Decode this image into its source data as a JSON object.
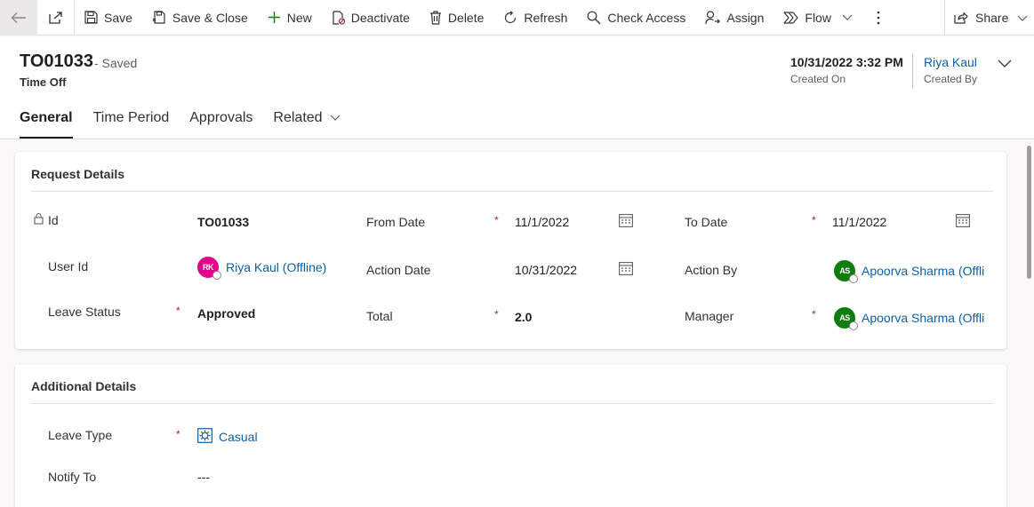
{
  "commands": {
    "save": "Save",
    "save_close": "Save & Close",
    "new": "New",
    "deactivate": "Deactivate",
    "delete": "Delete",
    "refresh": "Refresh",
    "check_access": "Check Access",
    "assign": "Assign",
    "flow": "Flow",
    "share": "Share"
  },
  "header": {
    "record_id": "TO01033",
    "save_status": "- Saved",
    "entity": "Time Off",
    "created_on_value": "10/31/2022 3:32 PM",
    "created_on_label": "Created On",
    "created_by_value": "Riya Kaul",
    "created_by_label": "Created By"
  },
  "tabs": [
    "General",
    "Time Period",
    "Approvals",
    "Related"
  ],
  "request_details": {
    "title": "Request Details",
    "id_label": "Id",
    "id_value": "TO01033",
    "from_date_label": "From Date",
    "from_date_value": "11/1/2022",
    "to_date_label": "To Date",
    "to_date_value": "11/1/2022",
    "user_id_label": "User Id",
    "user_initials": "RK",
    "user_value": "Riya Kaul (Offline)",
    "action_date_label": "Action Date",
    "action_date_value": "10/31/2022",
    "action_by_label": "Action By",
    "action_by_initials": "AS",
    "action_by_value": "Apoorva Sharma (Offli",
    "leave_status_label": "Leave Status",
    "leave_status_value": "Approved",
    "total_label": "Total",
    "total_value": "2.0",
    "manager_label": "Manager",
    "manager_initials": "AS",
    "manager_value": "Apoorva Sharma (Offli"
  },
  "additional_details": {
    "title": "Additional Details",
    "leave_type_label": "Leave Type",
    "leave_type_value": "Casual",
    "notify_to_label": "Notify To",
    "notify_to_value": "---"
  },
  "required_mark": "*",
  "colors": {
    "link": "#115ea3",
    "required": "#a4262c",
    "avatar_rk": "#e3008c",
    "avatar_as": "#107c10"
  }
}
